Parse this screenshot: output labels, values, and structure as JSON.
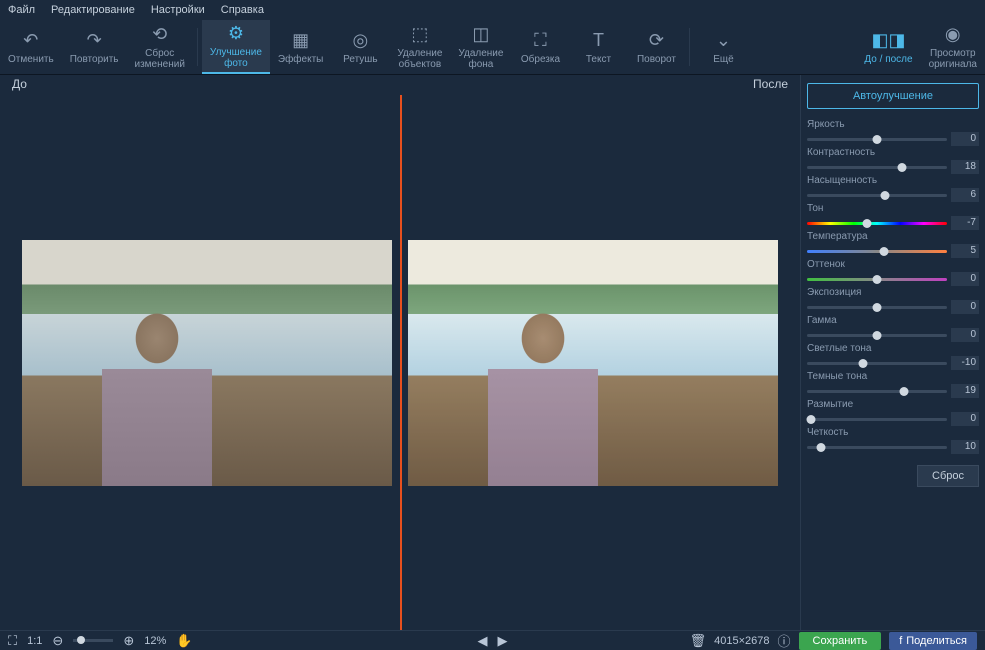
{
  "menu": {
    "file": "Файл",
    "edit": "Редактирование",
    "settings": "Настройки",
    "help": "Справка"
  },
  "toolbar": {
    "undo": "Отменить",
    "redo": "Повторить",
    "reset_changes": "Сброс\nизменений",
    "enhance": "Улучшение\nфото",
    "effects": "Эффекты",
    "retouch": "Ретушь",
    "object_removal": "Удаление\nобъектов",
    "bg_removal": "Удаление\nфона",
    "crop": "Обрезка",
    "text": "Текст",
    "rotate": "Поворот",
    "more": "Ещё",
    "before_after": "До / после",
    "view_original": "Просмотр\nоригинала"
  },
  "ba": {
    "before": "До",
    "after": "После"
  },
  "panel": {
    "auto": "Автоулучшение",
    "sliders": [
      {
        "label": "Яркость",
        "value": 0,
        "pos": 50
      },
      {
        "label": "Контрастность",
        "value": 18,
        "pos": 68
      },
      {
        "label": "Насыщенность",
        "value": 6,
        "pos": 56
      },
      {
        "label": "Тон",
        "value": -7,
        "pos": 43,
        "track": "hue"
      },
      {
        "label": "Температура",
        "value": 5,
        "pos": 55,
        "track": "temp"
      },
      {
        "label": "Оттенок",
        "value": 0,
        "pos": 50,
        "track": "tint"
      },
      {
        "label": "Экспозиция",
        "value": 0,
        "pos": 50
      },
      {
        "label": "Гамма",
        "value": 0,
        "pos": 50
      },
      {
        "label": "Светлые тона",
        "value": -10,
        "pos": 40
      },
      {
        "label": "Темные тона",
        "value": 19,
        "pos": 69
      },
      {
        "label": "Размытие",
        "value": 0,
        "pos": 3
      },
      {
        "label": "Четкость",
        "value": 10,
        "pos": 10
      }
    ],
    "reset": "Сброс"
  },
  "status": {
    "fit": "1:1",
    "zoom": "12%",
    "dimensions": "4015×2678",
    "save": "Сохранить",
    "share": "Поделиться"
  }
}
